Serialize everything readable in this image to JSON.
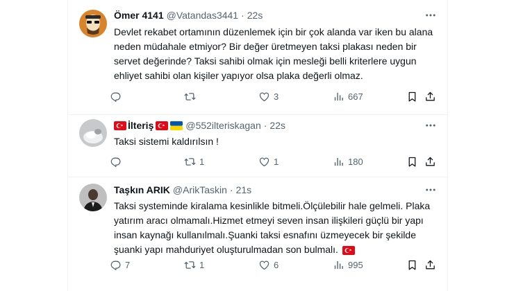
{
  "tweets": [
    {
      "name": "Ömer 4141",
      "handle": "@Vatandas3441",
      "time": "22s",
      "text": "Devlet rekabet ortamının düzenlemek için bir çok alanda var iken bu alana neden müdahale etmiyor? Bir değer üretmeyen taksi plakası neden bir servet değerinde? Taksi sahibi olmak için mesleği belli kriterlere uygun ehliyet sahibi olan kişiler yapıyor olsa plaka değerli olmaz.",
      "replies": "",
      "retweets": "",
      "likes": "3",
      "views": "667"
    },
    {
      "name": "İlteriş",
      "handle": "@552ilteriskagan",
      "time": "22s",
      "text": "Taksi sistemi kaldırılsın !",
      "replies": "",
      "retweets": "1",
      "likes": "1",
      "views": "180"
    },
    {
      "name": "Taşkın ARIK",
      "handle": "@ArikTaskin",
      "time": "21s",
      "text": "Taksi systeminde kiralama kesinlikle bitmeli.Ölçülebilir hale gelmeli. Plaka yatırım aracı olmamalı.Hizmet etmeyi seven insan ilişkileri güçlü bir yapı insan kaynağı kullanılmalı.Şuanki taksi esnafını üzmeyecek bir şekilde şuanki yapı mahduriyet oluşturulmadan son bulmalı.",
      "replies": "7",
      "retweets": "1",
      "likes": "6",
      "views": "995"
    }
  ],
  "icons": {
    "reply": "reply-icon",
    "retweet": "retweet-icon",
    "like": "heart-icon",
    "views": "views-icon",
    "bookmark": "bookmark-icon",
    "share": "share-icon",
    "more": "more-icon"
  },
  "colors": {
    "text": "#0f1419",
    "secondary": "#536471",
    "divider": "#eff3f4",
    "turkey_flag": "#e30a17",
    "ukraine_blue": "#0057b7",
    "ukraine_yellow": "#ffd700"
  }
}
